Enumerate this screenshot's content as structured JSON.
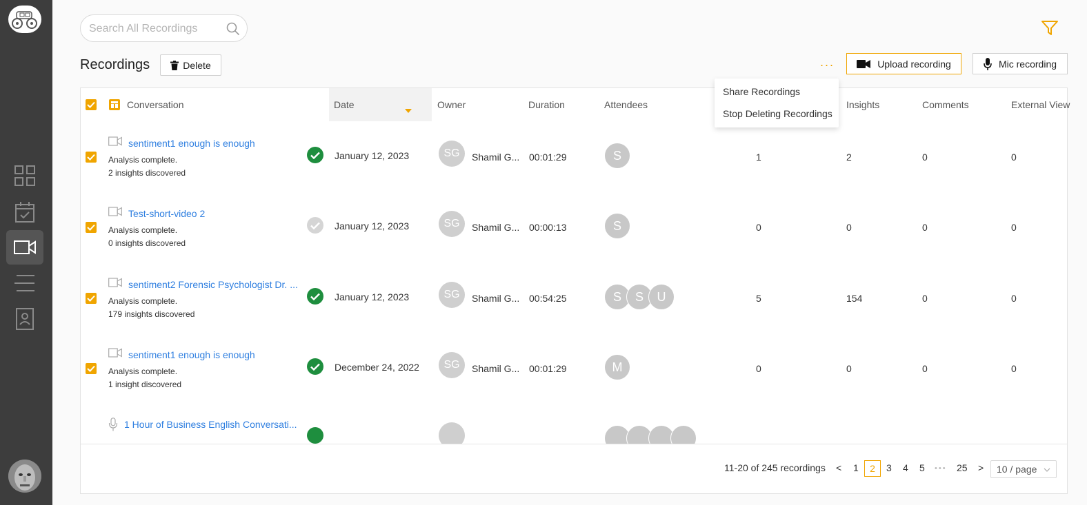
{
  "search": {
    "placeholder": "Search All Recordings"
  },
  "header": {
    "title": "Recordings",
    "delete_label": "Delete",
    "more_label": "···",
    "upload_label": "Upload recording",
    "mic_label": "Mic recording"
  },
  "menu": {
    "items": [
      "Share Recordings",
      "Stop Deleting Recordings"
    ]
  },
  "columns": {
    "conversation": "Conversation",
    "date": "Date",
    "owner": "Owner",
    "duration": "Duration",
    "attendees": "Attendees",
    "insights": "Insights",
    "comments": "Comments",
    "external": "External View"
  },
  "rows": [
    {
      "media": "video",
      "title": "sentiment1 enough is enough",
      "status_line": "Analysis complete.",
      "insights_line": "2 insights discovered",
      "status": "complete",
      "date": "January 12, 2023",
      "owner_initials": "SG",
      "owner_name": "Shamil G...",
      "duration": "00:01:29",
      "attendees": [
        "S"
      ],
      "col_a": "1",
      "insights": "2",
      "comments": "0",
      "external": "0"
    },
    {
      "media": "video",
      "title": "Test-short-video 2",
      "status_line": "Analysis complete.",
      "insights_line": "0 insights discovered",
      "status": "partial",
      "date": "January 12, 2023",
      "owner_initials": "SG",
      "owner_name": "Shamil G...",
      "duration": "00:00:13",
      "attendees": [
        "S"
      ],
      "col_a": "0",
      "insights": "0",
      "comments": "0",
      "external": "0"
    },
    {
      "media": "video",
      "title": "sentiment2 Forensic Psychologist Dr. ...",
      "status_line": "Analysis complete.",
      "insights_line": "179 insights discovered",
      "status": "complete",
      "date": "January 12, 2023",
      "owner_initials": "SG",
      "owner_name": "Shamil G...",
      "duration": "00:54:25",
      "attendees": [
        "S",
        "S",
        "U"
      ],
      "col_a": "5",
      "insights": "154",
      "comments": "0",
      "external": "0"
    },
    {
      "media": "video",
      "title": "sentiment1 enough is enough",
      "status_line": "Analysis complete.",
      "insights_line": "1 insight discovered",
      "status": "complete",
      "date": "December 24, 2022",
      "owner_initials": "SG",
      "owner_name": "Shamil G...",
      "duration": "00:01:29",
      "attendees": [
        "M"
      ],
      "col_a": "0",
      "insights": "0",
      "comments": "0",
      "external": "0"
    },
    {
      "media": "audio",
      "title": "1 Hour of Business English Conversati...",
      "status_line": "",
      "insights_line": "",
      "status": "complete",
      "date": "",
      "owner_initials": "",
      "owner_name": "",
      "duration": "",
      "attendees": [
        "",
        "",
        "",
        ""
      ],
      "col_a": "",
      "insights": "",
      "comments": "",
      "external": ""
    }
  ],
  "pagination": {
    "summary": "11-20 of 245 recordings",
    "prev": "<",
    "pages": [
      "1",
      "2",
      "3",
      "4",
      "5"
    ],
    "current": "2",
    "ellipsis": "•••",
    "last": "25",
    "next": ">",
    "page_size": "10 / page"
  },
  "colors": {
    "accent": "#f0a500",
    "link": "#2f7fe0",
    "success": "#1e8e3e",
    "sidebar": "#3d3d3d"
  }
}
